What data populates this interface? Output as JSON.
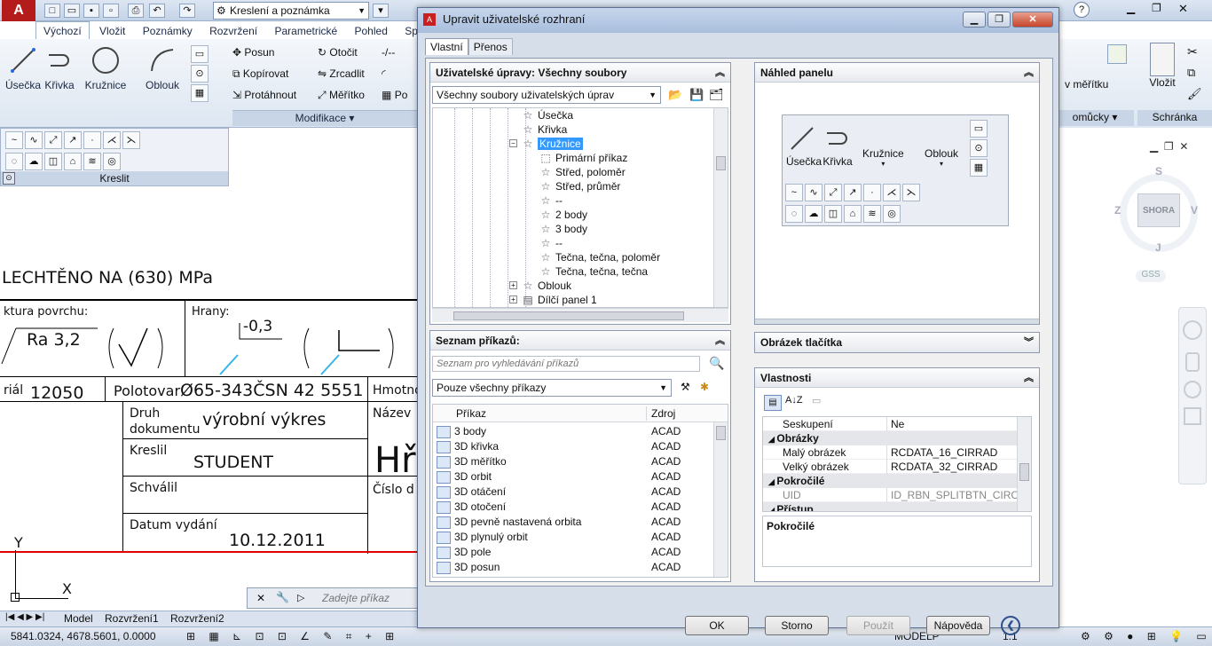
{
  "app": {
    "workspace": "Kreslení a poznámka"
  },
  "ribbon": {
    "tabs": [
      "Výchozí",
      "Vložit",
      "Poznámky",
      "Rozvržení",
      "Parametrické",
      "Pohled",
      "Sp"
    ],
    "draw_tools": [
      "Úsečka",
      "Křivka",
      "Kružnice",
      "Oblouk"
    ],
    "modify_tools": [
      "Posun",
      "Kopírovat",
      "Protáhnout",
      "Otočit",
      "Zrcadlit",
      "Měřítko",
      "Po"
    ],
    "modify_group": "Modifikace",
    "draw_group": "Kreslit",
    "right_labels": {
      "meritko": "v měřítku",
      "pomucky": "omůcky",
      "vlozit": "Vložit",
      "schranka": "Schránka"
    }
  },
  "drawing": {
    "text1": "LECHTĚNO NA (630) MPa",
    "drsnost_label": "ktura povrchu:",
    "drsnost_value": "Ra 3,2",
    "hrany_label": "Hrany:",
    "hrany_value": "-0,3",
    "material": "riál",
    "material_value": "12050",
    "polotovar": "Polotovar",
    "polotovar_value": "Ø65-343ČSN 42 5551",
    "hmotnost": "Hmotno",
    "druh_label1": "Druh",
    "druh_label2": "dokumentu",
    "druh_value": "výrobní výkres",
    "nazev": "Název",
    "kreslil": "Kreslil",
    "kreslil_value": "STUDENT",
    "hr": "Hř",
    "schvalil": "Schválil",
    "cislo": "Číslo d",
    "datum": "Datum vydání",
    "datum_value": "10.12.2011",
    "axis_y": "Y",
    "axis_x": "X"
  },
  "commandline": {
    "placeholder": "Zadejte příkaz"
  },
  "layout_tabs": [
    "Model",
    "Rozvržení1",
    "Rozvržení2"
  ],
  "status": {
    "coords": "5841.0324, 4678.5601, 0.0000",
    "model": "MODELP",
    "scale": "1:1"
  },
  "viewcube": {
    "top": "SHORA",
    "n": "S",
    "s": "J",
    "w": "Z",
    "e": "V",
    "wcs": "GSS"
  },
  "dialog": {
    "title": "Upravit uživatelské rozhraní",
    "tabs": [
      "Vlastní",
      "Přenos"
    ],
    "custom_header": "Uživatelské úpravy: Všechny soubory",
    "custom_combo": "Všechny soubory uživatelských úprav",
    "tree": [
      {
        "label": "Úsečka",
        "indent": 0,
        "icon": "star"
      },
      {
        "label": "Křivka",
        "indent": 0,
        "icon": "star"
      },
      {
        "label": "Kružnice",
        "indent": 0,
        "icon": "star",
        "selected": true,
        "expanded": true
      },
      {
        "label": "Primární příkaz",
        "indent": 1,
        "icon": "cmd"
      },
      {
        "label": "Střed, poloměr",
        "indent": 1,
        "icon": "star"
      },
      {
        "label": "Střed, průměr",
        "indent": 1,
        "icon": "star"
      },
      {
        "label": "--",
        "indent": 1,
        "icon": "star"
      },
      {
        "label": "2 body",
        "indent": 1,
        "icon": "star"
      },
      {
        "label": "3 body",
        "indent": 1,
        "icon": "star"
      },
      {
        "label": "--",
        "indent": 1,
        "icon": "star"
      },
      {
        "label": "Tečna, tečna, poloměr",
        "indent": 1,
        "icon": "star"
      },
      {
        "label": "Tečna, tečna, tečna",
        "indent": 1,
        "icon": "star"
      },
      {
        "label": "Oblouk",
        "indent": 0,
        "icon": "star",
        "collapsed": true
      },
      {
        "label": "Dílčí panel 1",
        "indent": 0,
        "icon": "panel",
        "collapsed": true
      }
    ],
    "cmdlist_header": "Seznam příkazů:",
    "cmd_search_placeholder": "Seznam pro vyhledávání příkazů",
    "cmd_filter": "Pouze všechny příkazy",
    "cmd_col_name": "Příkaz",
    "cmd_col_src": "Zdroj",
    "commands": [
      {
        "name": "3 body",
        "src": "ACAD"
      },
      {
        "name": "3D křivka",
        "src": "ACAD"
      },
      {
        "name": "3D měřítko",
        "src": "ACAD"
      },
      {
        "name": "3D orbit",
        "src": "ACAD"
      },
      {
        "name": "3D otáčení",
        "src": "ACAD"
      },
      {
        "name": "3D otočení",
        "src": "ACAD"
      },
      {
        "name": "3D pevně nastavená orbita",
        "src": "ACAD"
      },
      {
        "name": "3D plynulý orbit",
        "src": "ACAD"
      },
      {
        "name": "3D pole",
        "src": "ACAD"
      },
      {
        "name": "3D posun",
        "src": "ACAD"
      }
    ],
    "preview_header": "Náhled panelu",
    "preview_labels": [
      "Úsečka",
      "Křivka",
      "Kružnice",
      "Oblouk"
    ],
    "button_image_header": "Obrázek tlačítka",
    "props_header": "Vlastnosti",
    "props": [
      {
        "type": "row",
        "k": "Seskupení",
        "v": "Ne"
      },
      {
        "type": "cat",
        "k": "Obrázky"
      },
      {
        "type": "row",
        "k": "Malý obrázek",
        "v": "RCDATA_16_CIRRAD"
      },
      {
        "type": "row",
        "k": "Velký obrázek",
        "v": "RCDATA_32_CIRRAD"
      },
      {
        "type": "cat",
        "k": "Pokročilé"
      },
      {
        "type": "row",
        "k": "UID",
        "v": "ID_RBN_SPLITBTN_CIRCLE",
        "grey": true
      },
      {
        "type": "cat",
        "k": "Přístup"
      }
    ],
    "props_desc": "Pokročilé",
    "buttons": {
      "ok": "OK",
      "cancel": "Storno",
      "apply": "Použít",
      "help": "Nápověda"
    }
  }
}
